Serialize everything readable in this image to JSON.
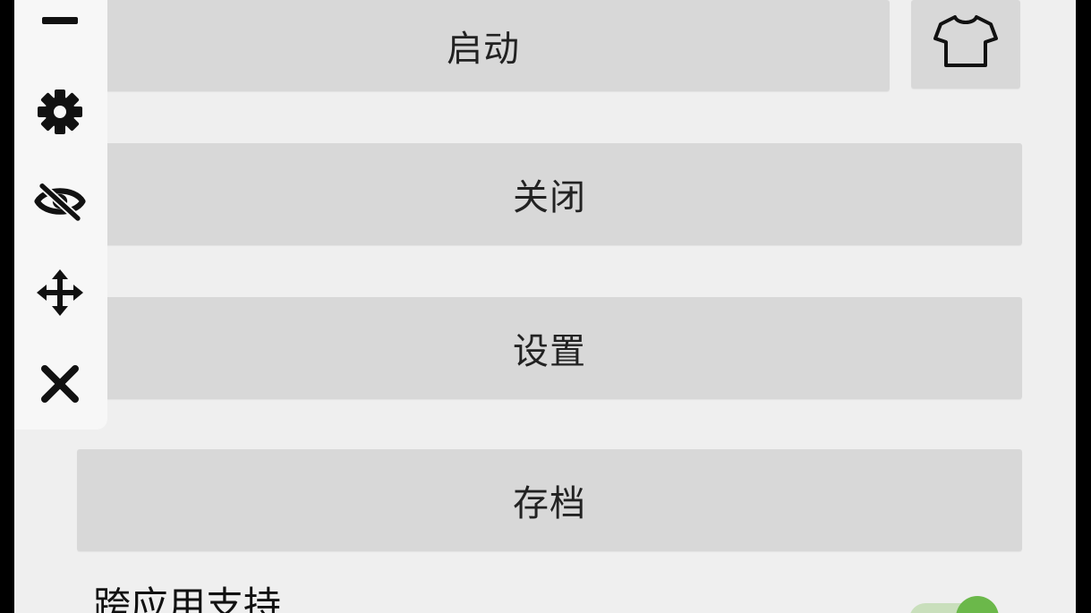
{
  "buttons": {
    "start_label": "启动",
    "close_label": "关闭",
    "settings_label": "设置",
    "save_label": "存档"
  },
  "toolbar": {
    "icons": [
      "minimize-icon",
      "gear-icon",
      "eye-off-icon",
      "move-icon",
      "close-icon"
    ]
  },
  "setting": {
    "label": "跨应用支持",
    "enabled": true
  },
  "colors": {
    "panel_bg": "#efefef",
    "button_bg": "#d8d8d8",
    "toggle_on": "#6bb84a"
  }
}
